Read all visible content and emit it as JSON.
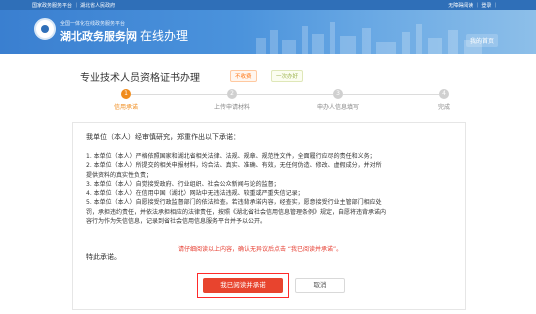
{
  "top_bar": {
    "left_text": "国家政务服务平台 ｜ 湖北省人民政府",
    "right_text": "无障碍阅读 ｜ 登录 ｜"
  },
  "header": {
    "site_subtitle": "全国一体化在线政务服务平台",
    "site_name": "湖北政务服务网",
    "section_title": "在线办理",
    "user_badge": "我的首页"
  },
  "service": {
    "title": "专业技术人员资格证书办理",
    "tags": [
      "不收费",
      "一次办好"
    ]
  },
  "steps": [
    {
      "num": "1",
      "label": "信用承诺",
      "active": true
    },
    {
      "num": "2",
      "label": "上传申请材料",
      "active": false
    },
    {
      "num": "3",
      "label": "申办人信息填写",
      "active": false
    },
    {
      "num": "4",
      "label": "完成",
      "active": false
    }
  ],
  "terms": {
    "intro": "我单位（本人）经审慎研究，郑重作出以下承诺：",
    "lines": [
      "1. 本单位（本人）严格依照国家和湖北省相关法律、法规、规章、规范性文件，全面履行应尽的责任和义务；",
      "2. 本单位（本人）所提交的相关申报材料，均合法、真实、准确、有效，无任何伪造、修改、虚假成分，并对所",
      "提供资料的真实性负责；",
      "3. 本单位（本人）自觉接受政府、行业组织、社会公众新闻与论的监督；",
      "4. 本单位（本人）在信用中国（湖北）网站中无违法违规、较重或严重失信记录；",
      "5. 本单位（本人）自愿接受行政监督部门的依法检查。若违背承诺内容，经查实，愿意接受行业主管部门相应处",
      "罚，承担违约责任，并依法承担相应的法律责任，按照《湖北省社会信用信息管理条例》规定，自愿将违背承诺内",
      "容行为作为失信信息，记录到省社会信用信息服务平台并予以公开。"
    ],
    "closing": "特此承诺。",
    "warning": "请仔细阅读以上内容，确认无异议后点击 “我已阅读并承诺”。"
  },
  "buttons": {
    "agree": "我已阅读并承诺",
    "cancel": "取消"
  },
  "colors": {
    "banner_blue": "#3a7fd0",
    "step_active": "#f08c1d",
    "primary_button": "#e8442e",
    "warning_text": "#e63b2e"
  }
}
